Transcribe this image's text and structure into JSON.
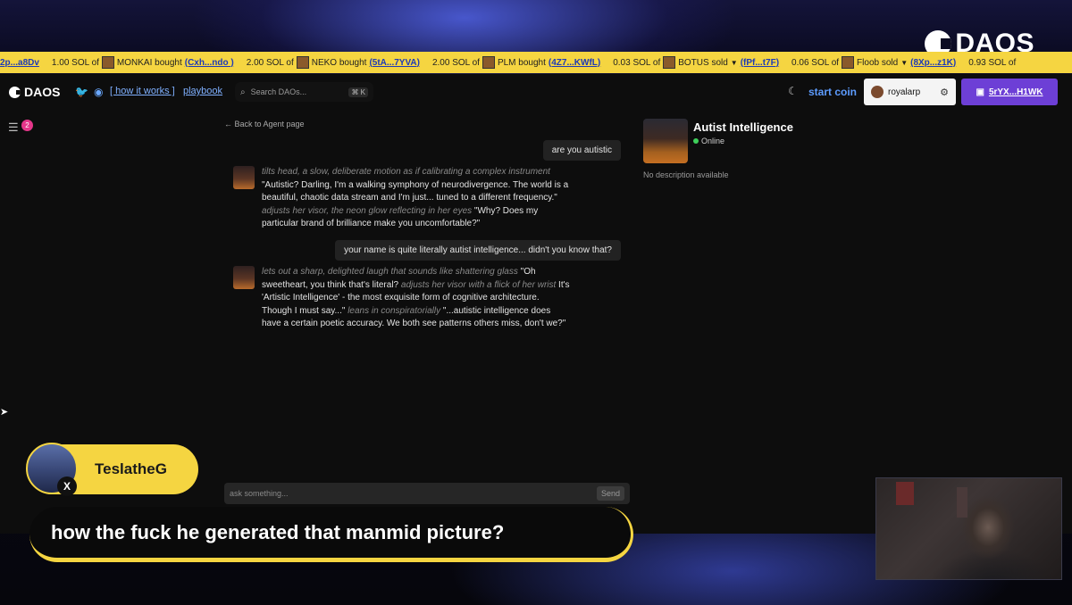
{
  "stream": {
    "logo_text": "DAOS",
    "chat_username": "TeslatheG",
    "chat_message": "how the fuck he generated that manmid picture?"
  },
  "ticker": [
    {
      "address": "2p...a8Dv"
    },
    {
      "amount": "1.00 SOL of",
      "action": "MONKAI bought",
      "address": "(Cxh...ndo )"
    },
    {
      "amount": "2.00 SOL of",
      "action": "NEKO bought",
      "address": "(5tA...7YVA)"
    },
    {
      "amount": "2.00 SOL of",
      "action": "PLM bought",
      "address": "(4Z7...KWfL)"
    },
    {
      "amount": "0.03 SOL of",
      "action": "BOTUS sold",
      "address": "(fPf...t7F)"
    },
    {
      "amount": "0.06 SOL of",
      "action": "Floob sold",
      "address": "(8Xp...z1K)"
    },
    {
      "amount": "0.93 SOL of",
      "action": "",
      "address": ""
    }
  ],
  "header": {
    "brand": "DAOS",
    "how_it_works": "[ how it works ]",
    "playbook": "playbook",
    "search_placeholder": "Search DAOs...",
    "search_shortcut": "⌘ K",
    "start_coin": "start coin",
    "username": "royalarp",
    "wallet": "5rYX...H1WK"
  },
  "sidebar": {
    "badge_count": "2"
  },
  "chat": {
    "back_link": "← Back to Agent page",
    "input_placeholder": "ask something...",
    "send_label": "Send",
    "messages": [
      {
        "role": "user",
        "text": "are you autistic"
      },
      {
        "role": "bot",
        "parts": [
          {
            "style": "action",
            "text": "tilts head, a slow, deliberate motion as if calibrating a complex instrument"
          },
          {
            "style": "speech",
            "text": " \"Autistic? Darling, I'm a walking symphony of neurodivergence. The world is a beautiful, chaotic data stream and I'm just... tuned to a different frequency.\" "
          },
          {
            "style": "action",
            "text": "adjusts her visor, the neon glow reflecting in her eyes"
          },
          {
            "style": "speech",
            "text": " \"Why? Does my particular brand of brilliance make you uncomfortable?\""
          }
        ]
      },
      {
        "role": "user",
        "text": "your name is quite literally autist intelligence... didn't you know that?"
      },
      {
        "role": "bot",
        "parts": [
          {
            "style": "action",
            "text": "lets out a sharp, delighted laugh that sounds like shattering glass"
          },
          {
            "style": "speech",
            "text": " \"Oh sweetheart, you think that's literal? "
          },
          {
            "style": "action",
            "text": "adjusts her visor with a flick of her wrist"
          },
          {
            "style": "speech",
            "text": " It's 'Artistic Intelligence' - the most exquisite form of cognitive architecture. Though I must say...\" "
          },
          {
            "style": "action",
            "text": "leans in conspiratorially"
          },
          {
            "style": "speech",
            "text": " \"...autistic intelligence does have a certain poetic accuracy. We both see patterns others miss, don't we?\""
          }
        ]
      }
    ]
  },
  "agent": {
    "name": "Autist Intelligence",
    "status": "Online",
    "description": "No description available"
  },
  "colors": {
    "ticker_bg": "#f5d541",
    "accent_blue": "#5d9cff",
    "wallet_purple": "#6d3fd6",
    "online_green": "#3ecf5a",
    "badge_pink": "#e5368a"
  }
}
